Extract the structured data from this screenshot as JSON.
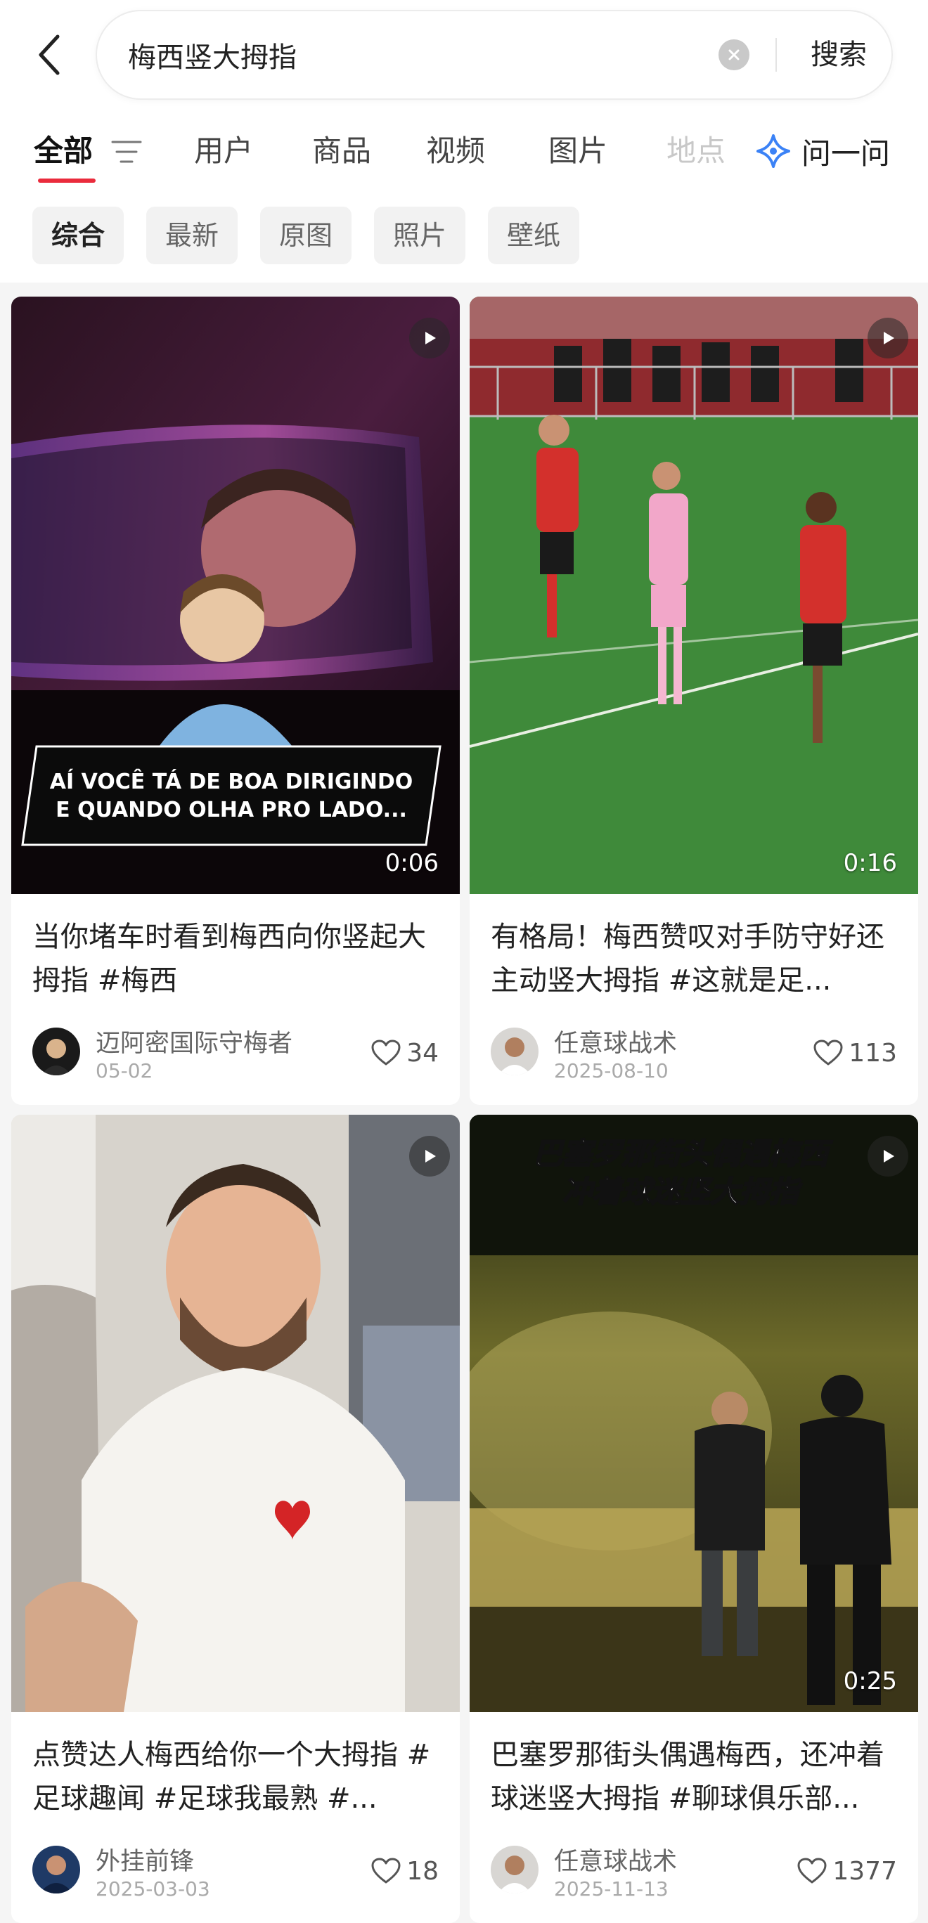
{
  "search": {
    "query": "梅西竖大拇指",
    "button_label": "搜索"
  },
  "tabs": [
    {
      "label": "全部",
      "active": true
    },
    {
      "label": "用户"
    },
    {
      "label": "商品"
    },
    {
      "label": "视频"
    },
    {
      "label": "图片"
    },
    {
      "label": "地点"
    }
  ],
  "ask_label": "问一问",
  "chips": [
    {
      "label": "综合",
      "active": true
    },
    {
      "label": "最新"
    },
    {
      "label": "原图"
    },
    {
      "label": "照片"
    },
    {
      "label": "壁纸"
    }
  ],
  "cards": [
    {
      "title": "当你堵车时看到梅西向你竖起大拇指 #梅西",
      "overlay_text_line1": "AÍ VOCÊ TÁ DE BOA DIRIGINDO",
      "overlay_text_line2": "E QUANDO OLHA PRO LADO...",
      "duration": "0:06",
      "author": "迈阿密国际守梅者",
      "date": "05-02",
      "likes": "34"
    },
    {
      "title": "有格局！梅西赞叹对手防守好还主动竖大拇指 #这就是足...",
      "duration": "0:16",
      "author": "任意球战术",
      "date": "2025-08-10",
      "likes": "113"
    },
    {
      "title": "点赞达人梅西给你一个大拇指 #足球趣闻 #足球我最熟 #...",
      "author": "外挂前锋",
      "date": "2025-03-03",
      "likes": "18"
    },
    {
      "title": "巴塞罗那街头偶遇梅西，还冲着球迷竖大拇指 #聊球俱乐部...",
      "overlay_text_line1": "巴塞罗那街头偶遇梅西",
      "overlay_text_line2": "冲着球迷竖大拇指",
      "duration": "0:25",
      "author": "任意球战术",
      "date": "2025-11-13",
      "likes": "1377"
    }
  ],
  "colors": {
    "accent": "#ea2b3c",
    "ask_icon": "#3b82f6"
  },
  "icons": [
    "back-arrow-icon",
    "clear-icon",
    "filter-icon",
    "sparkle-icon",
    "play-icon",
    "heart-icon"
  ]
}
